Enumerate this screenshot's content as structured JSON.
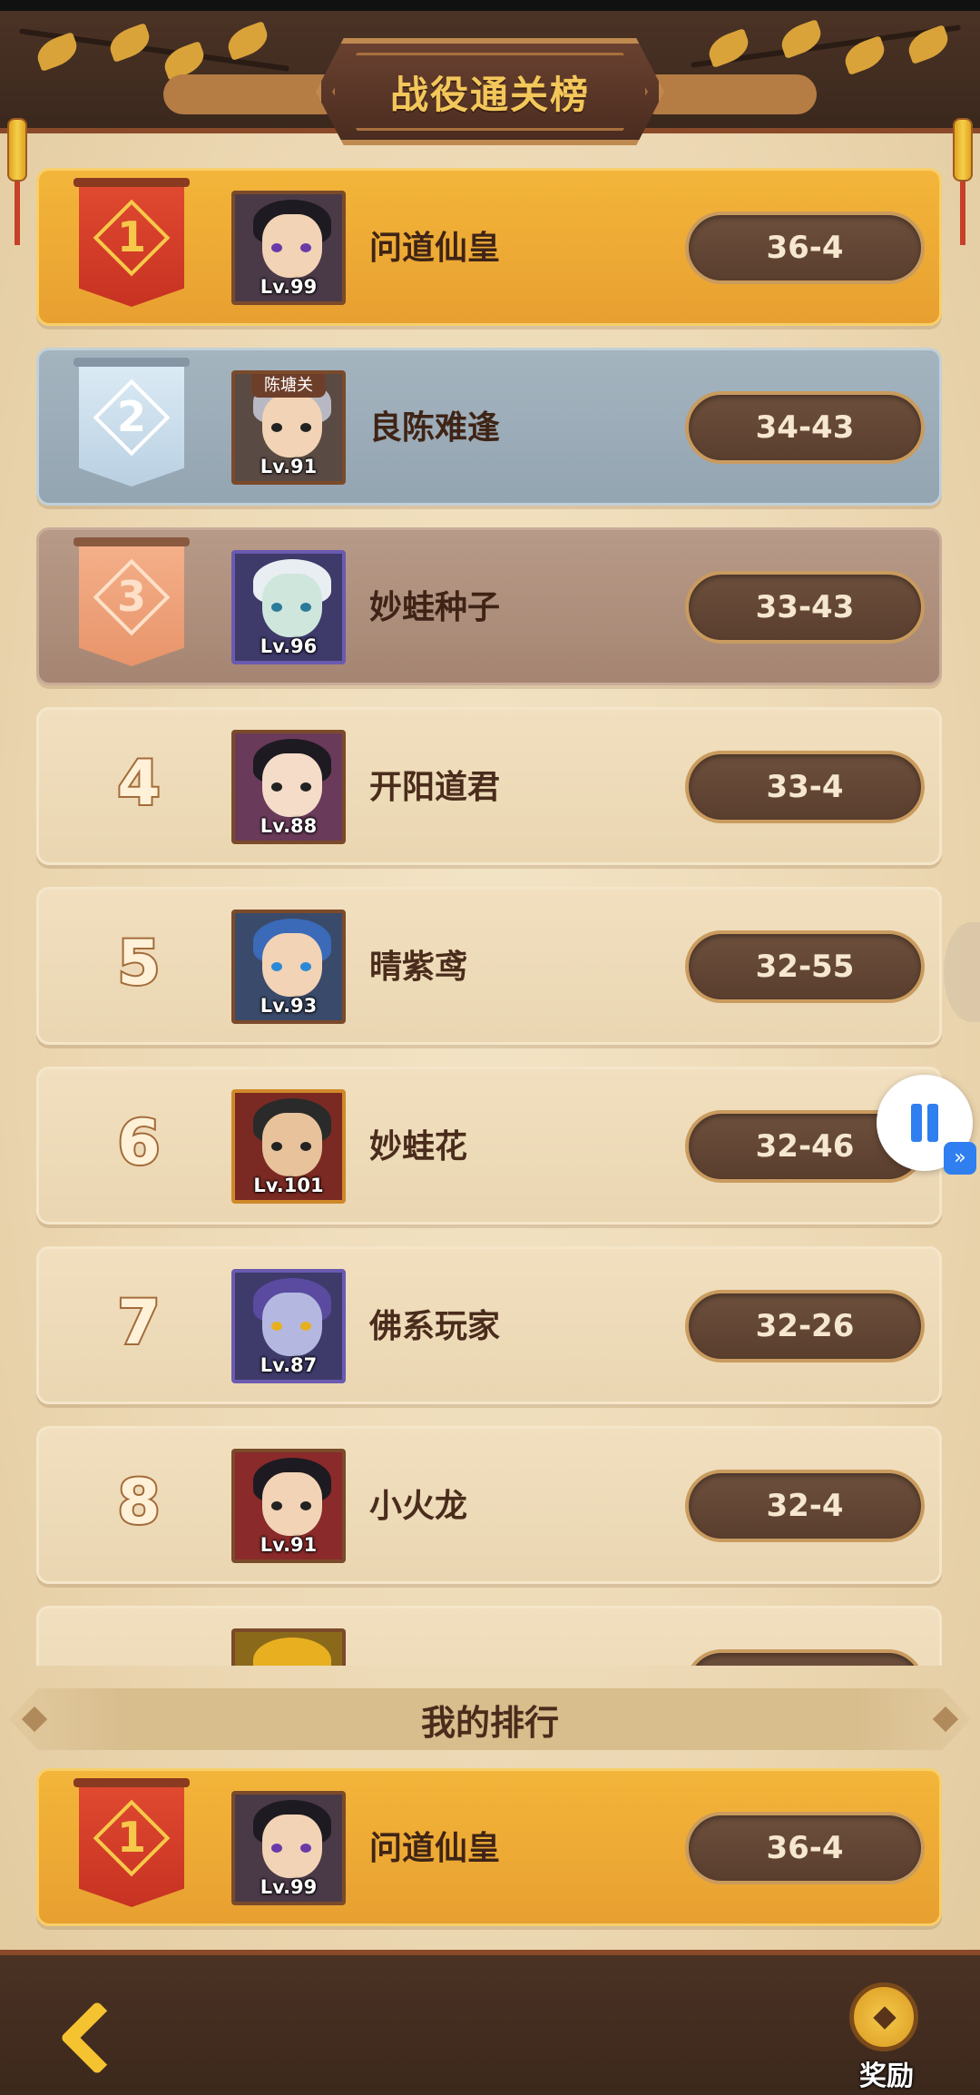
{
  "header": {
    "title": "战役通关榜"
  },
  "leaderboard": [
    {
      "rank": "1",
      "style": "gold",
      "name": "问道仙皇",
      "level": "Lv.99",
      "score": "36-4"
    },
    {
      "rank": "2",
      "style": "silver",
      "name": "良陈难逢",
      "level": "Lv.91",
      "tag": "陈塘关",
      "score": "34-43"
    },
    {
      "rank": "3",
      "style": "bronze",
      "name": "妙蛙种子",
      "level": "Lv.96",
      "score": "33-43"
    },
    {
      "rank": "4",
      "style": "plain",
      "name": "开阳道君",
      "level": "Lv.88",
      "score": "33-4"
    },
    {
      "rank": "5",
      "style": "plain",
      "name": "晴紫鸢",
      "level": "Lv.93",
      "score": "32-55"
    },
    {
      "rank": "6",
      "style": "plain",
      "name": "妙蛙花",
      "level": "Lv.101",
      "score": "32-46"
    },
    {
      "rank": "7",
      "style": "plain",
      "name": "佛系玩家",
      "level": "Lv.87",
      "score": "32-26"
    },
    {
      "rank": "8",
      "style": "plain",
      "name": "小火龙",
      "level": "Lv.91",
      "score": "32-4"
    }
  ],
  "my_rank": {
    "title": "我的排行",
    "rank": "1",
    "name": "问道仙皇",
    "level": "Lv.99",
    "score": "36-4"
  },
  "footer": {
    "reward_label": "奖励"
  },
  "colors": {
    "gold": "#f3b53a",
    "silver": "#a4b4bf",
    "bronze": "#b89a88",
    "plain": "#f1dfbf",
    "score_pill": "#5a3e2e",
    "accent_blue": "#2f7ff0"
  }
}
